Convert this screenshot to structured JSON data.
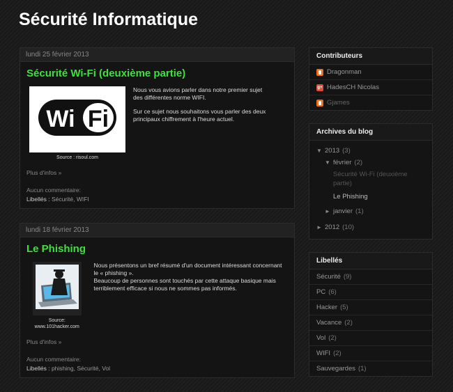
{
  "blog": {
    "title": "Sécurité Informatique"
  },
  "posts": [
    {
      "date": "lundi 25 février 2013",
      "title": "Sécurité Wi-Fi (deuxième partie)",
      "image_text": "Wi Fi",
      "caption": "Source : risoul.com",
      "paragraphs": [
        "Nous vous avions parler dans notre premier sujet des différentes norme WIFI.",
        "Sur ce sujet nous souhaitons vous parler des deux principaux chiffrement à l'heure actuel."
      ],
      "more": "Plus d'infos »",
      "comments": "Aucun commentaire:",
      "labels_prefix": "Libellés :",
      "labels": "Sécurité, WIFI"
    },
    {
      "date": "lundi 18 février 2013",
      "title": "Le Phishing",
      "caption": "Source: www.101hacker.com",
      "paragraphs": [
        "Nous présentons un bref résumé d'un document intéressant concernant le « phishing ».",
        "Beaucoup de personnes sont touchés par cette attaque basique mais terriblement efficace si nous ne sommes pas informés."
      ],
      "more": "Plus d'infos »",
      "comments": "Aucun commentaire:",
      "labels_prefix": "Libellés :",
      "labels": "phishing, Sécurité, Vol"
    }
  ],
  "sidebar": {
    "contributors": {
      "title": "Contributeurs",
      "items": [
        {
          "name": "Dragonman",
          "icon": "blogger-icon"
        },
        {
          "name": "HadesCH Nicolas",
          "icon": "google-plus-icon"
        },
        {
          "name": "Gjames",
          "icon": "blogger-icon"
        }
      ]
    },
    "archives": {
      "title": "Archives du blog",
      "year2013": {
        "toggle": "▼",
        "label": "2013",
        "count": "(3)"
      },
      "feb": {
        "toggle": "▼",
        "label": "février",
        "count": "(2)"
      },
      "posts": [
        "Sécurité Wi-Fi (deuxième partie)",
        "Le Phishing"
      ],
      "jan": {
        "toggle": "►",
        "label": "janvier",
        "count": "(1)"
      },
      "year2012": {
        "toggle": "►",
        "label": "2012",
        "count": "(10)"
      }
    },
    "labels": {
      "title": "Libellés",
      "items": [
        {
          "name": "Sécurité",
          "count": "(9)"
        },
        {
          "name": "PC",
          "count": "(6)"
        },
        {
          "name": "Hacker",
          "count": "(5)"
        },
        {
          "name": "Vacance",
          "count": "(2)"
        },
        {
          "name": "Vol",
          "count": "(2)"
        },
        {
          "name": "WIFI",
          "count": "(2)"
        },
        {
          "name": "Sauvegardes",
          "count": "(1)"
        }
      ]
    }
  },
  "colors": {
    "title_accent": "#3ee03e",
    "background": "#1c1c1c"
  }
}
